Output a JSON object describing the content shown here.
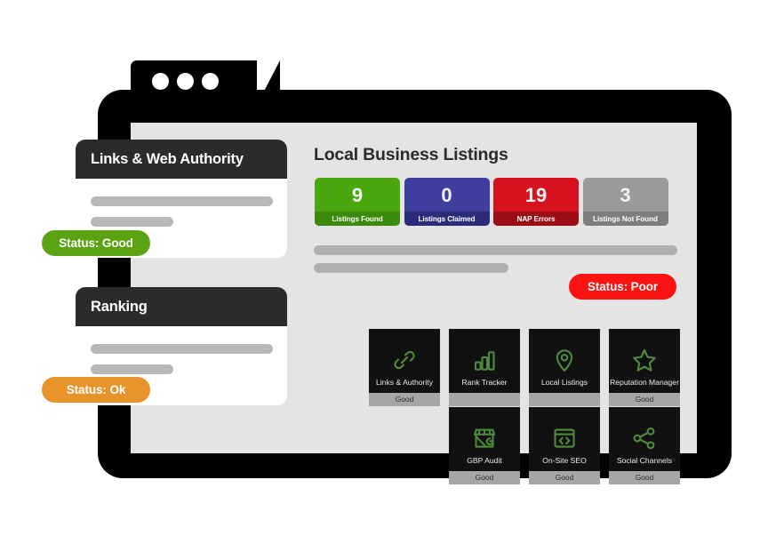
{
  "window": {
    "dots": [
      "window-dot",
      "window-dot",
      "window-dot"
    ]
  },
  "main": {
    "title": "Local Business Listings",
    "stats": [
      {
        "value": "9",
        "label": "Listings Found",
        "body_color": "#4aa80e",
        "footer_color": "#3c8a0b"
      },
      {
        "value": "0",
        "label": "Listings Claimed",
        "body_color": "#3f3f9e",
        "footer_color": "#2b2b7a"
      },
      {
        "value": "19",
        "label": "NAP Errors",
        "body_color": "#d5121e",
        "footer_color": "#9c0d16"
      },
      {
        "value": "3",
        "label": "Listings Not Found",
        "body_color": "#9a9a9a",
        "footer_color": "#7e7e7e"
      }
    ],
    "status_pill": {
      "label": "Status: Poor",
      "color": "#fb1313"
    },
    "tiles": [
      {
        "icon": "link-chain-icon",
        "label": "Links & Authority",
        "status": "Good"
      },
      {
        "icon": "bar-chart-icon",
        "label": "Rank Tracker",
        "status": ""
      },
      {
        "icon": "map-pin-icon",
        "label": "Local Listings",
        "status": ""
      },
      {
        "icon": "star-icon",
        "label": "Reputation Manager",
        "status": "Good"
      },
      {
        "icon": "storefront-icon",
        "label": "GBP Audit",
        "status": "Good"
      },
      {
        "icon": "code-window-icon",
        "label": "On-Site SEO",
        "status": "Good"
      },
      {
        "icon": "share-nodes-icon",
        "label": "Social Channels",
        "status": "Good"
      }
    ]
  },
  "cards": [
    {
      "title": "Links & Web Authority",
      "status_pill": {
        "label": "Status: Good",
        "color": "#5ca313"
      }
    },
    {
      "title": "Ranking",
      "status_pill": {
        "label": "Status: Ok",
        "color": "#e8922a"
      }
    }
  ]
}
